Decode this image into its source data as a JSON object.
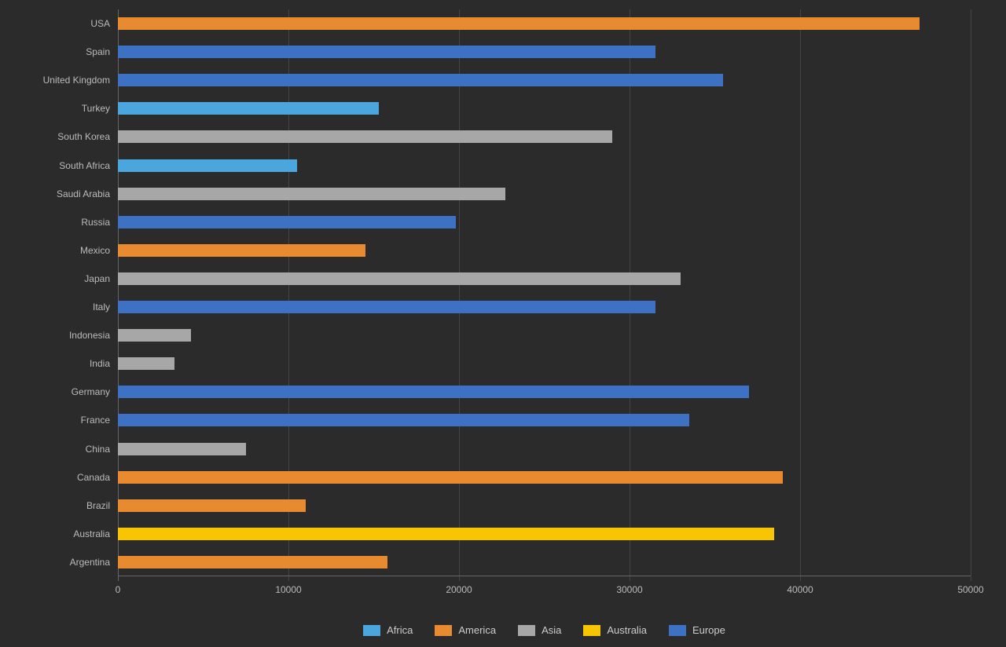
{
  "chart_data": {
    "type": "bar",
    "orientation": "horizontal",
    "title": "",
    "xlabel": "",
    "ylabel": "",
    "xlim": [
      0,
      50000
    ],
    "x_ticks": [
      0,
      10000,
      20000,
      30000,
      40000,
      50000
    ],
    "categories": [
      "USA",
      "Spain",
      "United Kingdom",
      "Turkey",
      "South Korea",
      "South Africa",
      "Saudi Arabia",
      "Russia",
      "Mexico",
      "Japan",
      "Italy",
      "Indonesia",
      "India",
      "Germany",
      "France",
      "China",
      "Canada",
      "Brazil",
      "Australia",
      "Argentina"
    ],
    "region_of": {
      "USA": "America",
      "Spain": "Europe",
      "United Kingdom": "Europe",
      "Turkey": "Africa",
      "South Korea": "Asia",
      "South Africa": "Africa",
      "Saudi Arabia": "Asia",
      "Russia": "Europe",
      "Mexico": "America",
      "Japan": "Asia",
      "Italy": "Europe",
      "Indonesia": "Asia",
      "India": "Asia",
      "Germany": "Europe",
      "France": "Europe",
      "China": "Asia",
      "Canada": "America",
      "Brazil": "America",
      "Australia": "Australia",
      "Argentina": "America"
    },
    "values": {
      "USA": 47000,
      "Spain": 31500,
      "United Kingdom": 35500,
      "Turkey": 15300,
      "South Korea": 29000,
      "South Africa": 10500,
      "Saudi Arabia": 22700,
      "Russia": 19800,
      "Mexico": 14500,
      "Japan": 33000,
      "Italy": 31500,
      "Indonesia": 4300,
      "India": 3300,
      "Germany": 37000,
      "France": 33500,
      "China": 7500,
      "Canada": 39000,
      "Brazil": 11000,
      "Australia": 38500,
      "Argentina": 15800
    },
    "legend": [
      "Africa",
      "America",
      "Asia",
      "Australia",
      "Europe"
    ],
    "colors": {
      "Africa": "#4aa6dc",
      "America": "#e78a30",
      "Asia": "#a7a7a7",
      "Australia": "#f7c504",
      "Europe": "#3c71c4"
    }
  }
}
